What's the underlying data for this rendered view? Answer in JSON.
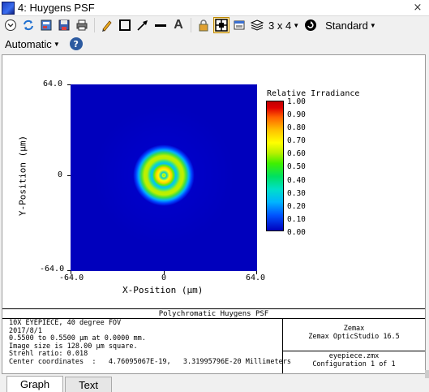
{
  "window": {
    "title": "4: Huygens PSF",
    "close_glyph": "×"
  },
  "toolbar": {
    "icons": [
      "dropdown-circle-icon",
      "refresh-icon",
      "settings-icon",
      "save-icon",
      "print-icon",
      "pencil-icon",
      "rectangle-icon",
      "arrow-icon",
      "line-icon",
      "text-icon",
      "lock-icon",
      "layout-icon",
      "window-icon",
      "layers-icon",
      "rotate-icon"
    ],
    "text_tool_label": "A",
    "layout_label": "3 x 4",
    "style_label": "Standard",
    "rescale_label": "Automatic",
    "help_label": "?"
  },
  "plot": {
    "x_axis_title": "X-Position (µm)",
    "y_axis_title": "Y-Position (µm)",
    "x_ticks": [
      "-64.0",
      "0",
      "64.0"
    ],
    "y_ticks": [
      "64.0",
      "0",
      "-64.0"
    ],
    "colorbar_title": "Relative Irradiance",
    "colorbar_ticks": [
      "1.00",
      "0.90",
      "0.80",
      "0.70",
      "0.60",
      "0.50",
      "0.40",
      "0.30",
      "0.20",
      "0.10",
      "0.00"
    ]
  },
  "chart_data": {
    "type": "heatmap",
    "xlabel": "X-Position (µm)",
    "ylabel": "Y-Position (µm)",
    "xlim": [
      -64.0,
      64.0
    ],
    "ylim": [
      -64.0,
      64.0
    ],
    "colorbar": {
      "label": "Relative Irradiance",
      "range": [
        0.0,
        1.0
      ]
    },
    "rings": [
      {
        "radius_um": 0,
        "value": 0.95
      },
      {
        "radius_um": 2,
        "value": 0.55
      },
      {
        "radius_um": 6,
        "value": 1.0
      },
      {
        "radius_um": 10,
        "value": 0.3
      },
      {
        "radius_um": 14,
        "value": 0.7
      },
      {
        "radius_um": 18,
        "value": 0.55
      },
      {
        "radius_um": 22,
        "value": 0.3
      },
      {
        "radius_um": 30,
        "value": 0.0
      }
    ]
  },
  "info": {
    "title": "Polychromatic Huygens PSF",
    "lines": [
      "10X EYEPIECE, 40 degree FOV",
      "2017/8/1",
      "0.5500 to 0.5500 µm at 0.0000 mm.",
      "Image size is 128.00 µm square.",
      "Strehl ratio: 0.018",
      "Center coordinates  :   4.76095067E-19,   3.31995796E-20 Millimeters"
    ],
    "company": "Zemax",
    "product": "Zemax OpticStudio 16.5",
    "file": "eyepiece.zmx",
    "configuration": "Configuration 1 of 1"
  },
  "tabs": [
    {
      "label": "Graph",
      "active": true
    },
    {
      "label": "Text",
      "active": false
    }
  ],
  "colors": {
    "background_blue": "#0000bd",
    "titlebar": "#ffffff",
    "active_tool": "#ffe8a6"
  }
}
